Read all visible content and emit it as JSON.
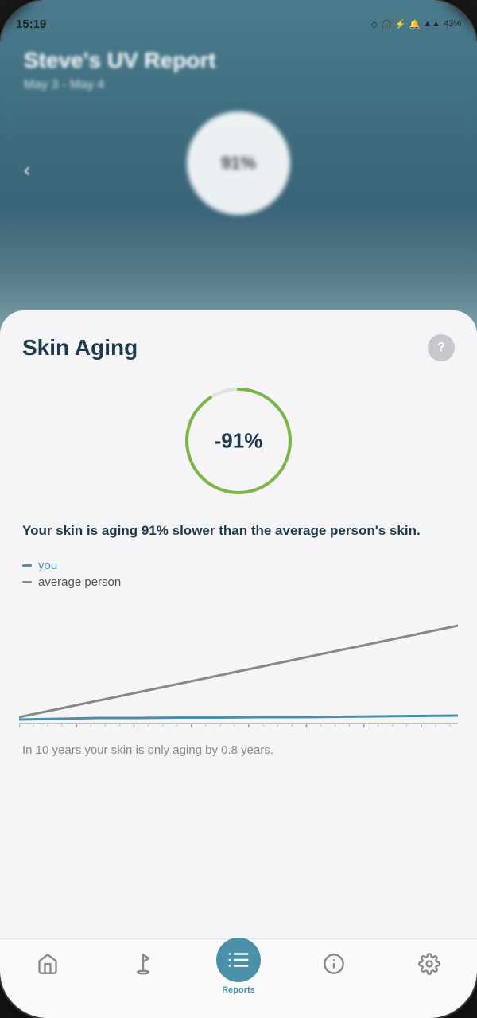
{
  "status_bar": {
    "time": "15:19",
    "battery": "43%"
  },
  "blurred_section": {
    "title": "Steve's UV Report",
    "subtitle": "May 3 - May 4",
    "circle_value": "91%"
  },
  "card": {
    "title": "Skin Aging",
    "help_label": "?",
    "percentage": "-91%",
    "description": "Your skin is aging 91% slower than the average person's skin.",
    "legend": {
      "you_label": "you",
      "avg_label": "average person"
    },
    "footer": "In 10 years your skin is only aging by 0.8 years."
  },
  "bottom_nav": {
    "items": [
      {
        "id": "home",
        "label": "",
        "icon": "home-icon"
      },
      {
        "id": "golf",
        "label": "",
        "icon": "golf-icon"
      },
      {
        "id": "reports",
        "label": "Reports",
        "icon": "reports-icon",
        "active": true
      },
      {
        "id": "info",
        "label": "",
        "icon": "info-icon"
      },
      {
        "id": "settings",
        "label": "",
        "icon": "settings-icon"
      }
    ]
  }
}
